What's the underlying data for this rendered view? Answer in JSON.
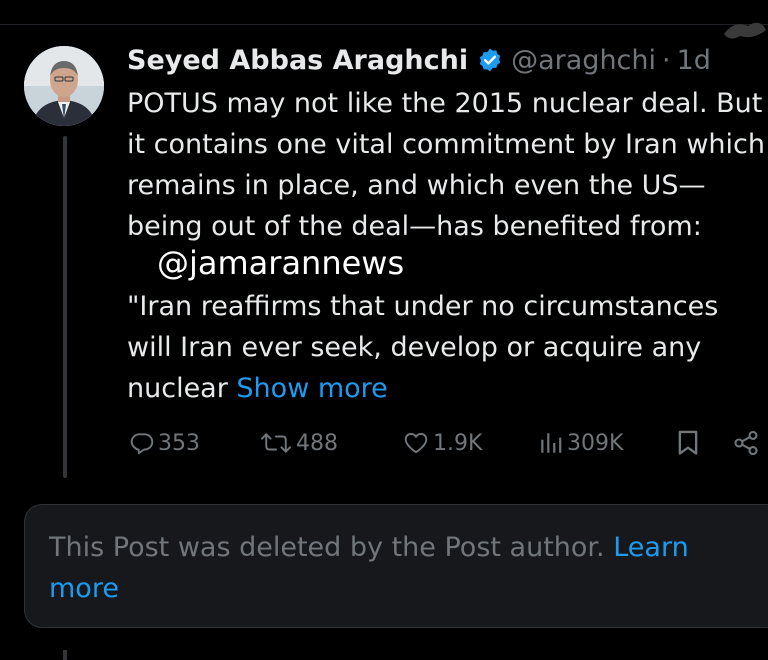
{
  "post": {
    "author_name": "Seyed Abbas Araghchi",
    "handle": "@araghchi",
    "separator": "·",
    "time": "1d",
    "text_lines": [
      "POTUS may not like the 2015 nuclear deal. But",
      "it contains one vital commitment by Iran which",
      "remains in place, and which even the US—",
      "being out of the deal—has benefited from:"
    ],
    "watermark": "@jamarannews",
    "quote_lines": [
      "\"Iran reaffirms that under no circumstances",
      "will Iran ever seek, develop or acquire any"
    ],
    "quote_last_prefix": "nuclear ",
    "show_more": "Show more",
    "replies": "353",
    "reposts": "488",
    "likes": "1.9K",
    "views": "309K"
  },
  "deleted_notice": {
    "text": "This Post was deleted by the Post author. ",
    "link_part1": "Learn",
    "link_part2": "more"
  },
  "colors": {
    "background": "#000000",
    "text": "#e7e9ea",
    "muted": "#71767b",
    "link": "#1d9bf0",
    "verified": "#1d9bf0"
  },
  "icons": [
    "verified-badge-icon",
    "reply-icon",
    "repost-icon",
    "like-icon",
    "views-icon",
    "bookmark-icon",
    "share-icon"
  ]
}
